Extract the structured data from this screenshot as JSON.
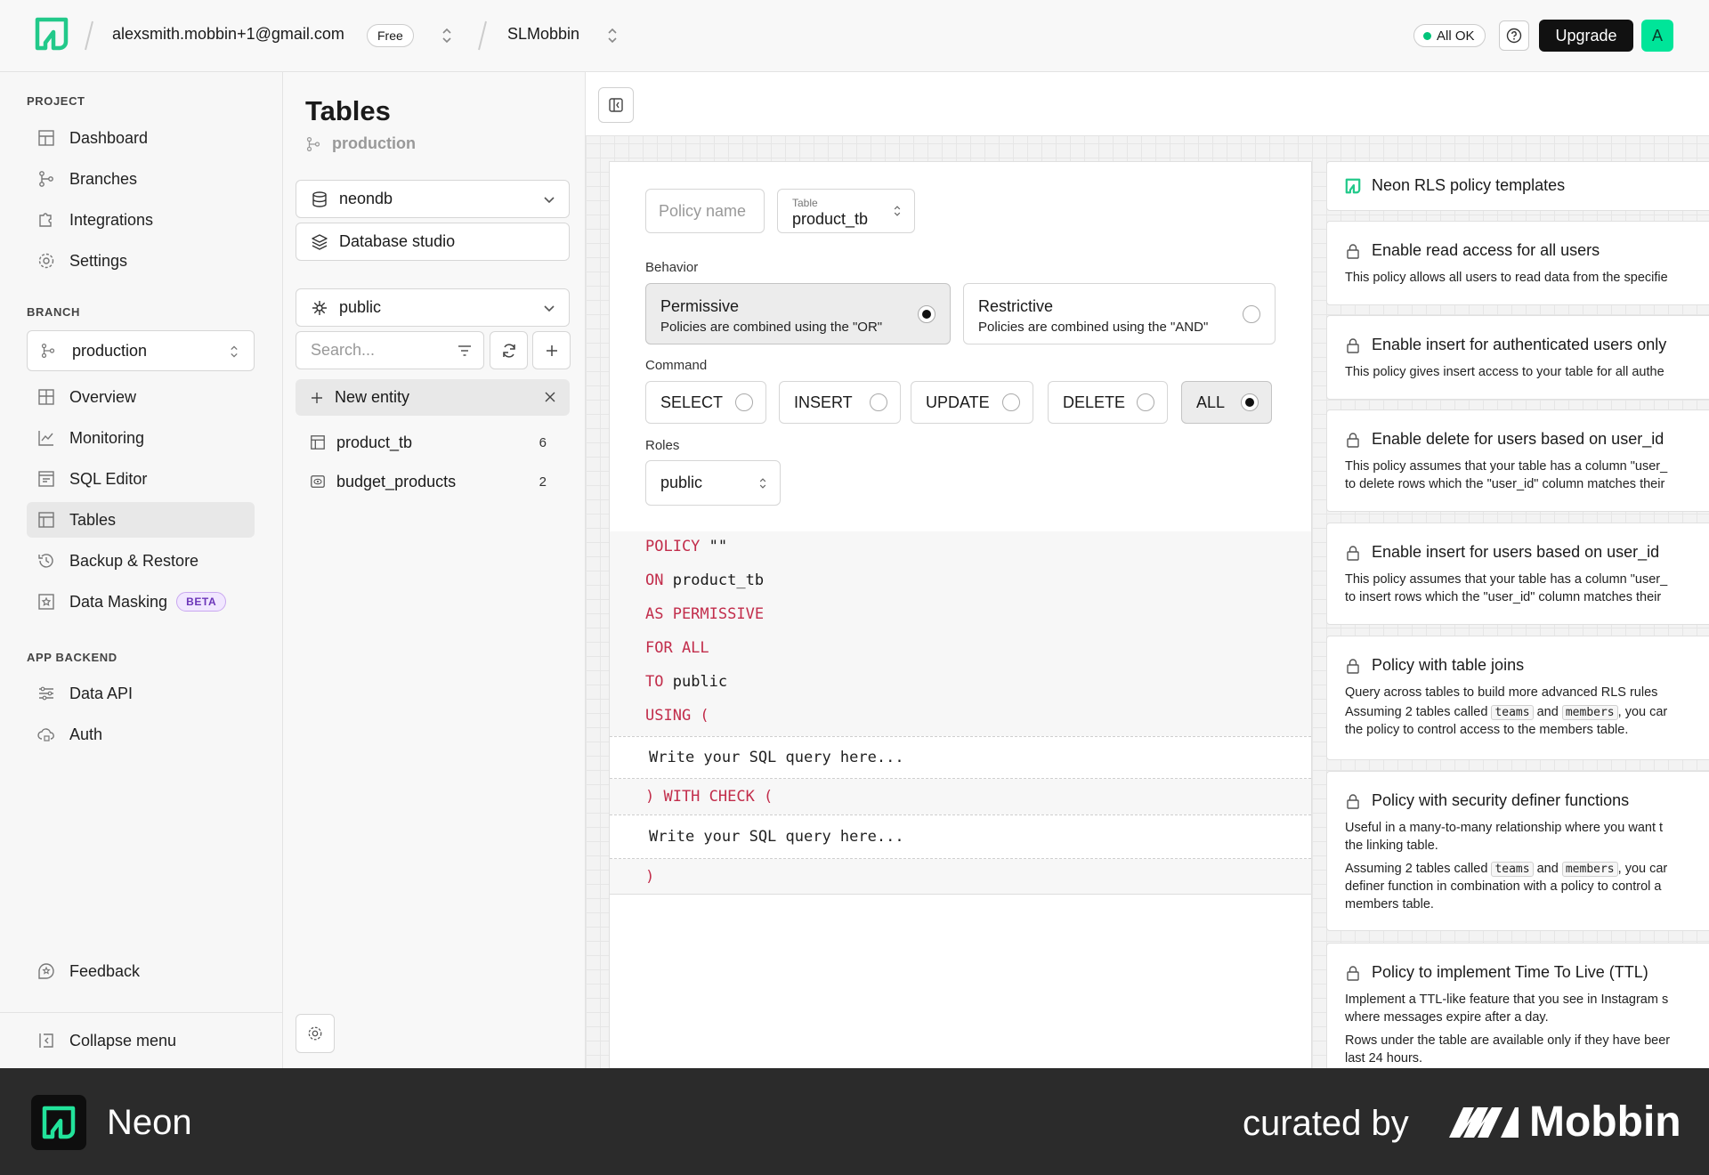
{
  "topbar": {
    "account_email": "alexsmith.mobbin+1@gmail.com",
    "plan_badge": "Free",
    "project_name": "SLMobbin",
    "status_label": "All OK",
    "upgrade_label": "Upgrade",
    "avatar_initial": "A"
  },
  "sidebar": {
    "project_heading": "PROJECT",
    "project_items": [
      "Dashboard",
      "Branches",
      "Integrations",
      "Settings"
    ],
    "branch_heading": "BRANCH",
    "branch_selector": "production",
    "branch_items": [
      "Overview",
      "Monitoring",
      "SQL Editor",
      "Tables",
      "Backup & Restore",
      "Data Masking"
    ],
    "beta_badge": "BETA",
    "backend_heading": "APP BACKEND",
    "backend_items": [
      "Data API",
      "Auth"
    ],
    "feedback_label": "Feedback",
    "collapse_label": "Collapse menu"
  },
  "tables_panel": {
    "title": "Tables",
    "branch": "production",
    "database": "neondb",
    "studio_label": "Database studio",
    "schema": "public",
    "search_placeholder": "Search...",
    "new_entity_label": "New entity",
    "tables": [
      {
        "name": "product_tb",
        "count": "6"
      },
      {
        "name": "budget_products",
        "count": "2"
      }
    ]
  },
  "policy_editor": {
    "policy_name_placeholder": "Policy name",
    "table_caption": "Table",
    "table_value": "product_tb",
    "behavior_label": "Behavior",
    "behaviors": [
      {
        "title": "Permissive",
        "desc": "Policies are combined using the \"OR\"",
        "selected": true
      },
      {
        "title": "Restrictive",
        "desc": "Policies are combined using the \"AND\"",
        "selected": false
      }
    ],
    "command_label": "Command",
    "commands": [
      "SELECT",
      "INSERT",
      "UPDATE",
      "DELETE",
      "ALL"
    ],
    "selected_command": "ALL",
    "roles_label": "Roles",
    "roles_value": "public",
    "sql": {
      "policy_kw": "POLICY",
      "policy_name": "\"\"",
      "on_kw": "ON",
      "on_val": "product_tb",
      "as_line": "AS PERMISSIVE",
      "for_line": "FOR ALL",
      "to_kw": "TO",
      "to_val": "public",
      "using_line": "USING (",
      "using_placeholder": "Write your SQL query here...",
      "check_line": ") WITH CHECK (",
      "check_placeholder": "Write your SQL query here...",
      "close_line": ")"
    }
  },
  "templates": {
    "header": "Neon RLS policy templates",
    "cards": [
      {
        "title": "Enable read access for all users",
        "lines": [
          "This policy allows all users to read data from the specifie"
        ]
      },
      {
        "title": "Enable insert for authenticated users only",
        "lines": [
          "This policy gives insert access to your table for all authe"
        ]
      },
      {
        "title": "Enable delete for users based on user_id",
        "lines": [
          "This policy assumes that your table has a column \"user_",
          "to delete rows which the \"user_id\" column matches their"
        ]
      },
      {
        "title": "Enable insert for users based on user_id",
        "lines": [
          "This policy assumes that your table has a column \"user_",
          "to insert rows which the \"user_id\" column matches their"
        ]
      },
      {
        "title": "Policy with table joins",
        "lines": [
          "Query across tables to build more advanced RLS rules"
        ],
        "joins_pre": "Assuming 2 tables called",
        "code_teams": "teams",
        "and_word": "and",
        "code_members": "members",
        "joins_post": ", you car",
        "joins_line2": "the policy to control access to the members table."
      },
      {
        "title": "Policy with security definer functions",
        "lines": [
          "Useful in a many-to-many relationship where you want t",
          "the linking table."
        ],
        "joins_pre": "Assuming 2 tables called",
        "code_teams": "teams",
        "and_word": "and",
        "code_members": "members",
        "joins_post": ", you car",
        "joins_line2": "definer function in combination with a policy to control a",
        "joins_line3": "members table."
      },
      {
        "title": "Policy to implement Time To Live (TTL)",
        "lines": [
          "Implement a TTL-like feature that you see in Instagram s",
          "where messages expire after a day.",
          "Rows under the table are available only if they have beer",
          "last 24 hours."
        ]
      }
    ]
  },
  "footer": {
    "app_name": "Neon",
    "curated_by": "curated by",
    "brand": "Mobbin"
  },
  "colors": {
    "accent": "#00e599",
    "sql_keyword": "#c22d4b",
    "footer_bg": "#2b2b2b"
  }
}
